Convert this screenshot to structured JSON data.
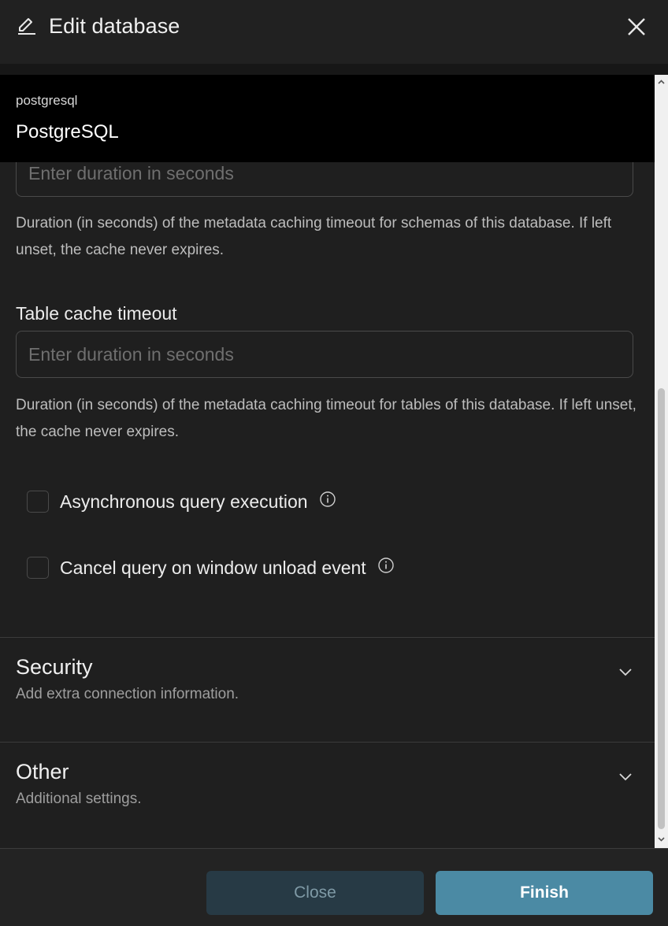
{
  "header": {
    "title": "Edit database",
    "edit_icon": "pencil-icon",
    "close_icon": "close-icon"
  },
  "database": {
    "engine": "postgresql",
    "name": "PostgreSQL"
  },
  "schema_cache": {
    "placeholder": "Enter duration in seconds",
    "help": "Duration (in seconds) of the metadata caching timeout for schemas of this database. If left unset, the cache never expires."
  },
  "table_cache": {
    "label": "Table cache timeout",
    "placeholder": "Enter duration in seconds",
    "help": "Duration (in seconds) of the metadata caching timeout for tables of this database. If left unset, the cache never expires."
  },
  "checkboxes": [
    {
      "label": "Asynchronous query execution",
      "checked": false
    },
    {
      "label": "Cancel query on window unload event",
      "checked": false
    }
  ],
  "sections": [
    {
      "title": "Security",
      "subtitle": "Add extra connection information."
    },
    {
      "title": "Other",
      "subtitle": "Additional settings."
    }
  ],
  "footer": {
    "close_label": "Close",
    "finish_label": "Finish"
  },
  "colors": {
    "background": "#1f1f1f",
    "primary_button": "#4b8aa4",
    "secondary_button": "#273a45"
  }
}
